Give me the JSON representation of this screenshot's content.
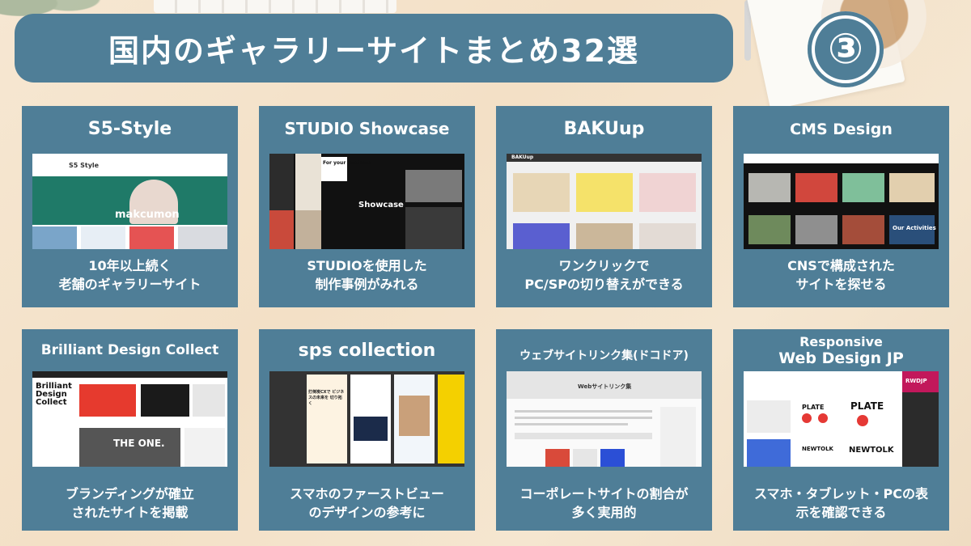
{
  "header": {
    "title": "国内のギャラリーサイトまとめ32選",
    "badge": "③"
  },
  "colors": {
    "accent": "#4f7e97",
    "text_on_accent": "#ffffff",
    "background": "#f5e6d0"
  },
  "cards": [
    {
      "title": "S5-Style",
      "desc_line1": "10年以上続く",
      "desc_line2": "老舗のギャラリーサイト",
      "shot": {
        "logo": "S5 Style",
        "overlay": "makcumon"
      }
    },
    {
      "title": "STUDIO Showcase",
      "desc_line1": "STUDIOを使用した",
      "desc_line2": "制作事例がみれる",
      "shot": {
        "headline": "Showcase",
        "tag": "For your Business"
      }
    },
    {
      "title": "BAKUup",
      "desc_line1": "ワンクリックで",
      "desc_line2": "PC/SPの切り替えができる",
      "shot": {
        "logo": "BAKUup"
      }
    },
    {
      "title": "CMS Design",
      "desc_line1": "CNSで構成された",
      "desc_line2": "サイトを探せる",
      "shot": {
        "caption": "Our Activities"
      }
    },
    {
      "title": "Brilliant Design Collect",
      "desc_line1": "ブランディングが確立",
      "desc_line2": "されたサイトを掲載",
      "shot": {
        "logo_line1": "Brilliant",
        "logo_line2": "Design",
        "logo_line3": "Collect",
        "feature": "THE ONE."
      }
    },
    {
      "title": "sps collection",
      "desc_line1": "スマホのファーストビュー",
      "desc_line2": "のデザインの参考に",
      "shot": {
        "headline": "打倒炭CXで ビジネスの未来を 切り拓く"
      }
    },
    {
      "title": "ウェブサイトリンク集(ドコドア)",
      "desc_line1": "コーポレートサイトの割合が",
      "desc_line2": "多く実用的",
      "shot": {
        "headline": "Webサイトリンク集"
      }
    },
    {
      "title_line1": "Responsive",
      "title_line2": "Web Design JP",
      "desc_line1": "スマホ・タブレット・PCの表",
      "desc_line2": "示を確認できる",
      "shot": {
        "logo": "RWDJP",
        "brand": "PLATE",
        "brand2": "NEWTOLK"
      }
    }
  ]
}
